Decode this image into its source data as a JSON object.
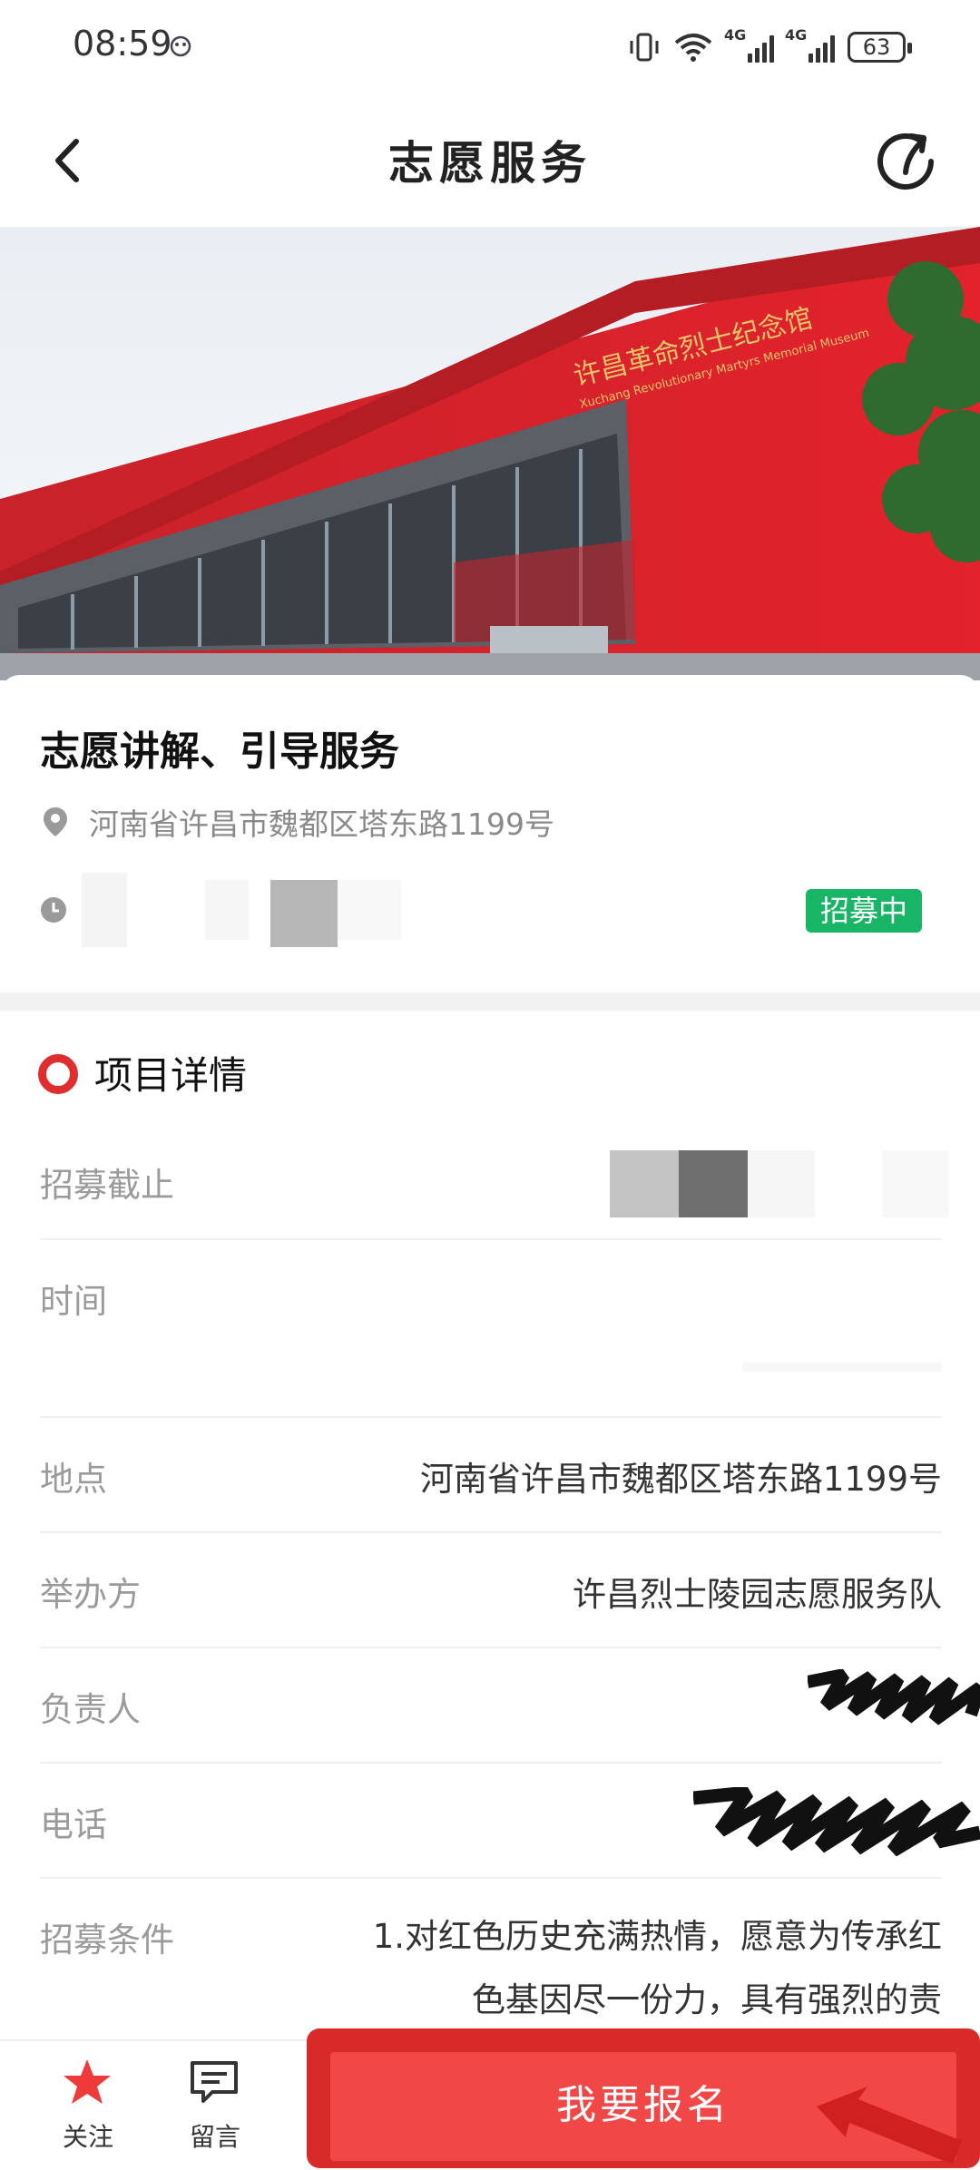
{
  "status_bar": {
    "time": "08:59",
    "network_1": "4G",
    "network_2": "4G",
    "battery": "63"
  },
  "nav": {
    "title": "志愿服务"
  },
  "hero": {
    "sign_cn": "许昌革命烈士纪念馆",
    "sign_en": "Xuchang Revolutionary Martyrs Memorial Museum"
  },
  "activity": {
    "title": "志愿讲解、引导服务",
    "address": "河南省许昌市魏都区塔东路1199号",
    "status": "招募中"
  },
  "details": {
    "section_title": "项目详情",
    "rows": [
      {
        "label": "招募截止",
        "value": ""
      },
      {
        "label": "时间",
        "value": ""
      },
      {
        "label": "地点",
        "value": "河南省许昌市魏都区塔东路1199号"
      },
      {
        "label": "举办方",
        "value": "许昌烈士陵园志愿服务队"
      },
      {
        "label": "负责人",
        "value": ""
      },
      {
        "label": "电话",
        "value": ""
      },
      {
        "label": "招募条件",
        "value": "1.对红色历史充满热情，愿意为传承红色基因尽一份力，具有强烈的责"
      }
    ]
  },
  "bottom_bar": {
    "follow_label": "关注",
    "message_label": "留言",
    "signup_label": "我要报名"
  },
  "colors": {
    "accent": "#f24747",
    "badge_green": "#19b566",
    "section_ring": "#e02e2e"
  },
  "icons": [
    "back-arrow-icon",
    "share-icon",
    "location-pin-icon",
    "clock-icon",
    "star-icon",
    "message-icon"
  ]
}
